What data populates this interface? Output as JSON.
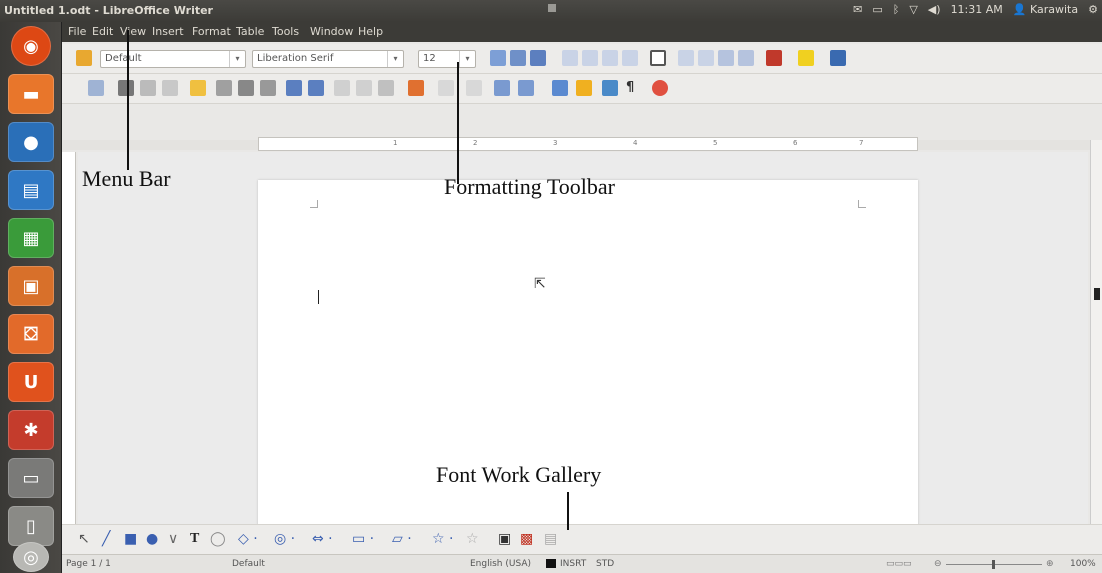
{
  "window": {
    "title": "Untitled 1.odt - LibreOffice Writer"
  },
  "top_panel": {
    "time": "11:31 AM",
    "user": "Karawita",
    "indicators": [
      "mail-icon",
      "battery-icon",
      "bluetooth-icon",
      "wifi-icon",
      "volume-icon"
    ]
  },
  "menu": [
    "File",
    "Edit",
    "View",
    "Insert",
    "Format",
    "Table",
    "Tools",
    "Window",
    "Help"
  ],
  "formatting_toolbar": {
    "paragraph_style": "Default",
    "font_name": "Liberation Serif",
    "font_size": "12"
  },
  "ruler": {
    "labels": [
      "1",
      "2",
      "3",
      "4",
      "5",
      "6",
      "7"
    ]
  },
  "status": {
    "page": "Page 1 / 1",
    "style": "Default",
    "language": "English (USA)",
    "insert_mode": "INSRT",
    "selection_mode": "STD",
    "zoom": "100%"
  },
  "annotations": {
    "menu_bar": "Menu Bar",
    "formatting_toolbar": "Formatting Toolbar",
    "font_work_gallery": "Font Work Gallery"
  },
  "colors": {
    "panel": "#3c3b37",
    "toolbar": "#edecea",
    "page": "#ffffff",
    "accent": "#dd4814"
  },
  "launcher_icons": [
    "ubuntu-dash-icon",
    "files-icon",
    "firefox-icon",
    "writer-icon",
    "calc-icon",
    "impress-icon",
    "software-center-icon",
    "ubuntu-one-icon",
    "system-settings-icon",
    "workspace-icon",
    "usb-drive-icon",
    "dvd-icon",
    "trash-icon"
  ]
}
